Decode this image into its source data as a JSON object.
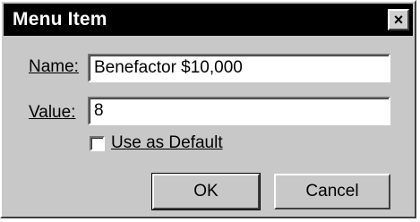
{
  "window": {
    "title": "Menu Item",
    "close_glyph": "×"
  },
  "form": {
    "name_label": "Name:",
    "name_value": "Benefactor $10,000",
    "value_label": "Value:",
    "value_value": "8",
    "default_checkbox_label": "Use as Default",
    "default_checked": false
  },
  "buttons": {
    "ok": "OK",
    "cancel": "Cancel"
  }
}
